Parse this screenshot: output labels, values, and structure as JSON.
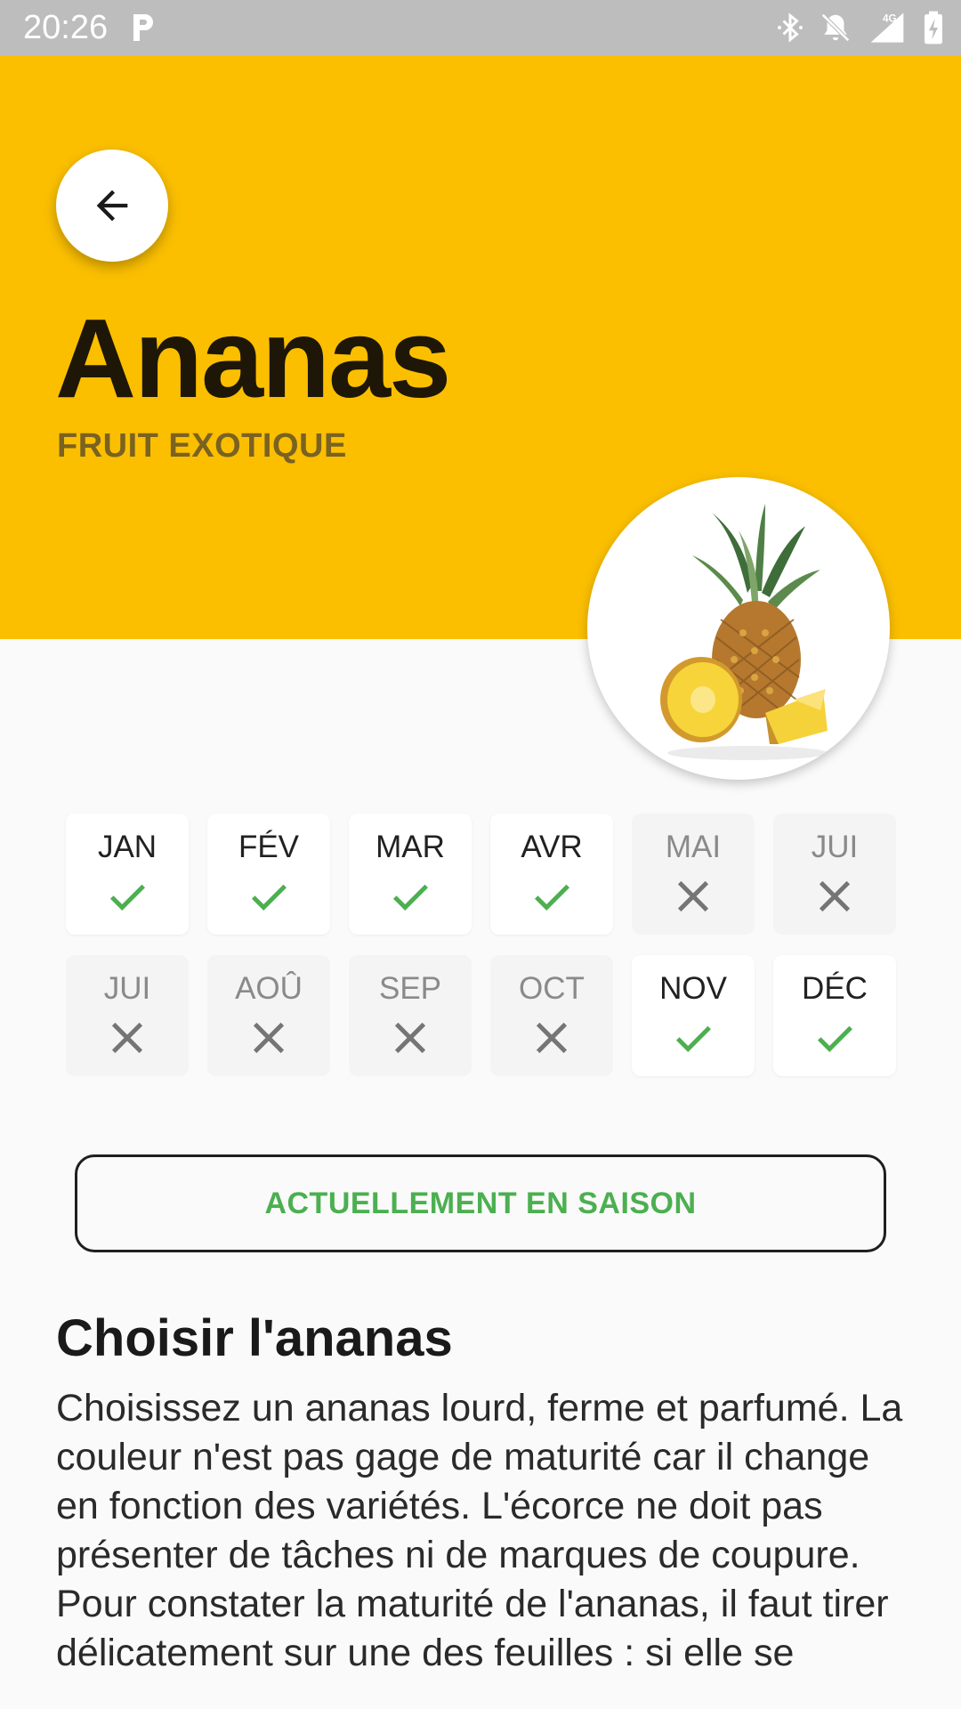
{
  "status_bar": {
    "time": "20:26",
    "icons": [
      "parking-icon",
      "bluetooth-icon",
      "notifications-off-icon",
      "signal-4g-icon",
      "battery-charging-icon"
    ],
    "network_label": "4G"
  },
  "header": {
    "background_color": "#fbbf00",
    "title": "Ananas",
    "subtitle": "FRUIT EXOTIQUE"
  },
  "months": [
    {
      "label": "JAN",
      "in_season": true
    },
    {
      "label": "FÉV",
      "in_season": true
    },
    {
      "label": "MAR",
      "in_season": true
    },
    {
      "label": "AVR",
      "in_season": true
    },
    {
      "label": "MAI",
      "in_season": false
    },
    {
      "label": "JUI",
      "in_season": false
    },
    {
      "label": "JUI",
      "in_season": false
    },
    {
      "label": "AOÛ",
      "in_season": false
    },
    {
      "label": "SEP",
      "in_season": false
    },
    {
      "label": "OCT",
      "in_season": false
    },
    {
      "label": "NOV",
      "in_season": true
    },
    {
      "label": "DÉC",
      "in_season": true
    }
  ],
  "season_button": {
    "label": "ACTUELLEMENT EN SAISON",
    "color": "#4caf50"
  },
  "section": {
    "title": "Choisir l'ananas",
    "body": "Choisissez un ananas lourd, ferme et parfumé. La couleur n'est pas gage de maturité car il change en fonction des variétés. L'écorce ne doit pas présenter de tâches ni de marques de coupure. Pour constater la maturité de l'ananas, il faut tirer délicatement sur une des feuilles : si elle se"
  },
  "colors": {
    "in_season_check": "#4caf50",
    "out_of_season_cross": "#757575"
  }
}
